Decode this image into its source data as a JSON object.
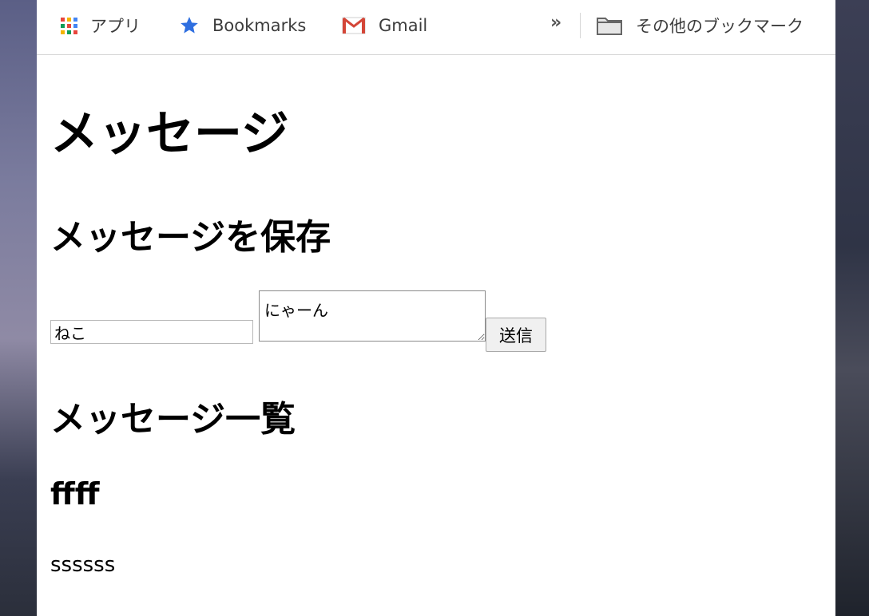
{
  "bookmarks_bar": {
    "apps_label": "アプリ",
    "bookmarks_label": "Bookmarks",
    "gmail_label": "Gmail",
    "overflow_chevron": "»",
    "other_bookmarks_label": "その他のブックマーク"
  },
  "page": {
    "title": "メッセージ",
    "save_heading": "メッセージを保存",
    "name_input_value": "ねこ",
    "message_textarea_value": "にゃーん",
    "send_button_label": "送信",
    "list_heading": "メッセージ一覧",
    "messages": [
      {
        "title": "ffff",
        "body": "ssssss"
      }
    ]
  },
  "colors": {
    "bookmark_star": "#2f6fe0",
    "gmail_red": "#d44638",
    "apps_grid": [
      "#e8453c",
      "#f4b400",
      "#4285f4",
      "#0f9d58",
      "#e8453c",
      "#4285f4",
      "#f4b400",
      "#0f9d58",
      "#e8453c"
    ]
  }
}
